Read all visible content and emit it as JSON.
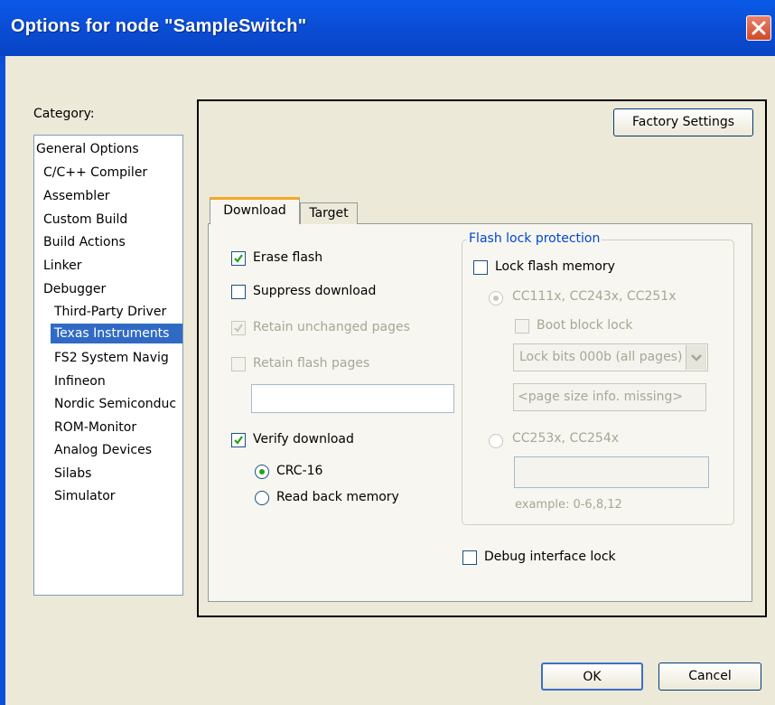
{
  "window": {
    "title": "Options for node \"SampleSwitch\""
  },
  "category": {
    "label": "Category:",
    "items": [
      {
        "label": "General Options"
      },
      {
        "label": "C/C++ Compiler"
      },
      {
        "label": "Assembler"
      },
      {
        "label": "Custom Build"
      },
      {
        "label": "Build Actions"
      },
      {
        "label": "Linker"
      },
      {
        "label": "Debugger"
      },
      {
        "label": "Third-Party Driver"
      },
      {
        "label": "Texas Instruments"
      },
      {
        "label": "FS2 System Navig"
      },
      {
        "label": "Infineon"
      },
      {
        "label": "Nordic Semiconduc"
      },
      {
        "label": "ROM-Monitor"
      },
      {
        "label": "Analog Devices"
      },
      {
        "label": "Silabs"
      },
      {
        "label": "Simulator"
      }
    ],
    "selected": "Texas Instruments"
  },
  "factory_settings_label": "Factory Settings",
  "tabs": [
    {
      "label": "Download"
    },
    {
      "label": "Target"
    }
  ],
  "download": {
    "erase_flash": "Erase flash",
    "suppress_download": "Suppress download",
    "retain_unchanged_pages": "Retain unchanged  pages",
    "retain_flash_pages": "Retain flash pages",
    "verify_download": "Verify download",
    "crc16": "CRC-16",
    "read_back_memory": "Read back memory"
  },
  "flash_lock": {
    "title": "Flash lock protection",
    "lock_flash_memory": "Lock flash memory",
    "cc111x": "CC111x, CC243x, CC251x",
    "boot_block_lock": "Boot block lock",
    "lock_bits_value": "Lock bits 000b (all pages)",
    "page_size_info": "<page size info. missing>",
    "cc253x": "CC253x, CC254x",
    "example": "example: 0-6,8,12"
  },
  "debug_interface_lock": "Debug interface lock",
  "buttons": {
    "ok": "OK",
    "cancel": "Cancel"
  }
}
